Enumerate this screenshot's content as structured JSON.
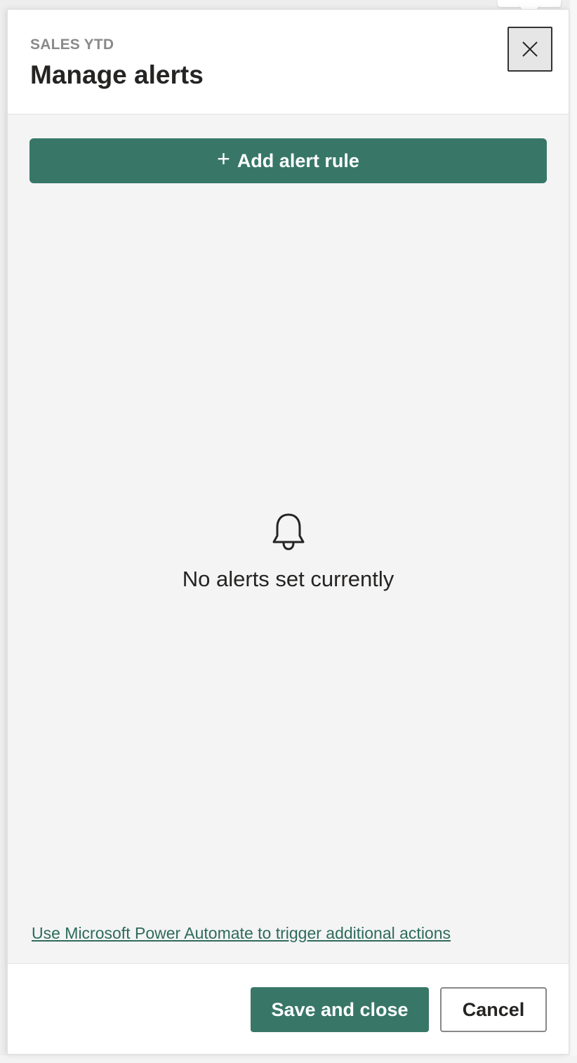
{
  "header": {
    "eyebrow": "SALES YTD",
    "title": "Manage alerts",
    "close_icon": "close-icon"
  },
  "actions": {
    "add_rule_label": "Add alert rule",
    "add_rule_icon": "plus-icon"
  },
  "empty_state": {
    "icon": "bell-icon",
    "message": "No alerts set currently"
  },
  "links": {
    "power_automate": "Use Microsoft Power Automate to trigger additional actions"
  },
  "footer": {
    "save_label": "Save and close",
    "cancel_label": "Cancel"
  },
  "colors": {
    "accent": "#387768",
    "link": "#2e6b5c",
    "text": "#252423",
    "muted": "#8a8a8a"
  }
}
